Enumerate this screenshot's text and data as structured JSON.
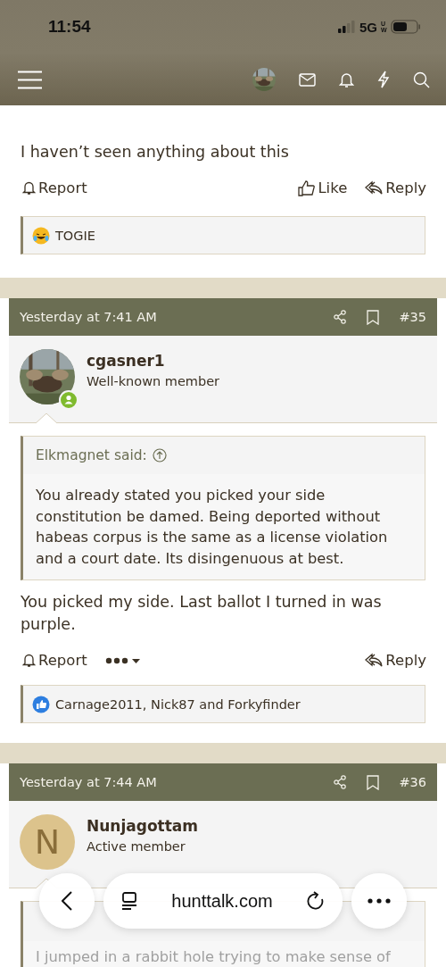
{
  "status_bar": {
    "time": "11:54",
    "network": "5G",
    "network_sub": "UW"
  },
  "posts": [
    {
      "body": "I haven’t seen anything about this",
      "actions": [
        {
          "kind": "report",
          "label": "Report"
        },
        {
          "kind": "like",
          "label": "Like"
        },
        {
          "kind": "reply",
          "label": "Reply"
        }
      ],
      "reactions": {
        "kind": "haha",
        "text": "TOGIE"
      }
    },
    {
      "header": {
        "time": "Yesterday at 7:41 AM",
        "number": "#35"
      },
      "author": {
        "name": "cgasner1",
        "title": "Well-known member",
        "online": true
      },
      "quote": {
        "author_parts": [
          "Elkmagnet said:"
        ],
        "text": "You already stated you picked your side constitution be damed. Being deported without habeas corpus is the same as a license violation and a court date. Its disingenuous at best."
      },
      "body": "You picked my side. Last ballot I turned in was purple.",
      "actions": [
        {
          "kind": "report",
          "label": "Report"
        },
        {
          "kind": "more"
        },
        {
          "kind": "reply",
          "label": "Reply"
        }
      ],
      "reactions": {
        "kind": "like",
        "text": "Carnage2011, Nick87 and Forkyfinder"
      }
    },
    {
      "header": {
        "time": "Yesterday at 7:44 AM",
        "number": "#36"
      },
      "author": {
        "name": "Nunjagottam",
        "title": "Active member",
        "avatar": {
          "kind": "letter",
          "letter": "N"
        }
      },
      "quote": {
        "faded": true,
        "text": "I jumped in a rabbit hole trying to make sense of"
      }
    }
  ],
  "browser_bar": {
    "url": "hunttalk.com"
  }
}
